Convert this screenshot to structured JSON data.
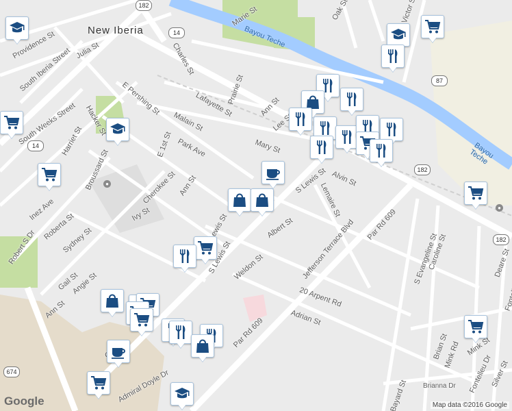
{
  "map": {
    "town_label": "New Iberia",
    "water_label": "Bayou Teche",
    "attribution": "Map data ©2016 Google",
    "logo": "Google",
    "highway_shields": [
      "182",
      "14",
      "87",
      "182",
      "182",
      "14",
      "674"
    ],
    "street_labels": [
      "Marie St",
      "Oak St",
      "Victor St",
      "Providence St",
      "South Iberia Street",
      "Julia St",
      "Charles St",
      "Prairie St",
      "Ann St",
      "Lafayette St",
      "Malain St",
      "E Pershing St",
      "South Weeks Street",
      "Harriet St",
      "Hacker St",
      "E 1st St",
      "Park Ave",
      "Mary St",
      "Lee St",
      "Broussard St",
      "Cherokee St",
      "Ann St",
      "Alvin St",
      "S Lewis St",
      "Lemaire St",
      "Inez Ave",
      "Roberta St",
      "Sydney St",
      "Robert S Dr",
      "Ivy St",
      "Gail St",
      "Angie St",
      "Ann St",
      "Albert St",
      "Weldon St",
      "Jefferson Terrace Blvd",
      "Par Rd 609",
      "20 Arpent Rd",
      "Adrian St",
      "S Evangeline St",
      "Caroline St",
      "Deare St",
      "Fontelleu St",
      "Brian St",
      "Mink Rd",
      "Mink St",
      "Silver St",
      "Fontelleu Dr",
      "Bayard St",
      "Brianna Dr",
      "Par Rd 609",
      "Admiral Doyle Dr",
      "Cent",
      "S Lewis St",
      "S Lewis St"
    ]
  },
  "markers": [
    {
      "icon": "school"
    },
    {
      "icon": "school"
    },
    {
      "icon": "shopping-cart"
    },
    {
      "icon": "shopping-cart"
    },
    {
      "icon": "restaurant"
    },
    {
      "icon": "shopping-cart"
    },
    {
      "icon": "school"
    },
    {
      "icon": "shopping-cart"
    },
    {
      "icon": "restaurant"
    },
    {
      "icon": "shopping-bag"
    },
    {
      "icon": "restaurant"
    },
    {
      "icon": "restaurant"
    },
    {
      "icon": "restaurant"
    },
    {
      "icon": "restaurant"
    },
    {
      "icon": "restaurant"
    },
    {
      "icon": "restaurant"
    },
    {
      "icon": "shopping-cart"
    },
    {
      "icon": "restaurant"
    },
    {
      "icon": "restaurant"
    },
    {
      "icon": "coffee"
    },
    {
      "icon": "shopping-bag"
    },
    {
      "icon": "shopping-bag"
    },
    {
      "icon": "shopping-cart"
    },
    {
      "icon": "restaurant"
    },
    {
      "icon": "shopping-bag"
    },
    {
      "icon": "shopping-bag"
    },
    {
      "icon": "shopping-cart"
    },
    {
      "icon": "shopping-cart"
    },
    {
      "icon": "shopping-cart"
    },
    {
      "icon": "restaurant"
    },
    {
      "icon": "restaurant"
    },
    {
      "icon": "restaurant"
    },
    {
      "icon": "shopping-bag"
    },
    {
      "icon": "coffee"
    },
    {
      "icon": "shopping-cart"
    },
    {
      "icon": "school"
    },
    {
      "icon": "shopping-cart"
    }
  ],
  "colors": {
    "background": "#ebebeb",
    "road": "#ffffff",
    "highway": "#ffffff",
    "water": "#a3ccff",
    "park": "#c5dea2",
    "marker_icon": "#1b4d82",
    "marker_border": "#a8c3dd"
  }
}
